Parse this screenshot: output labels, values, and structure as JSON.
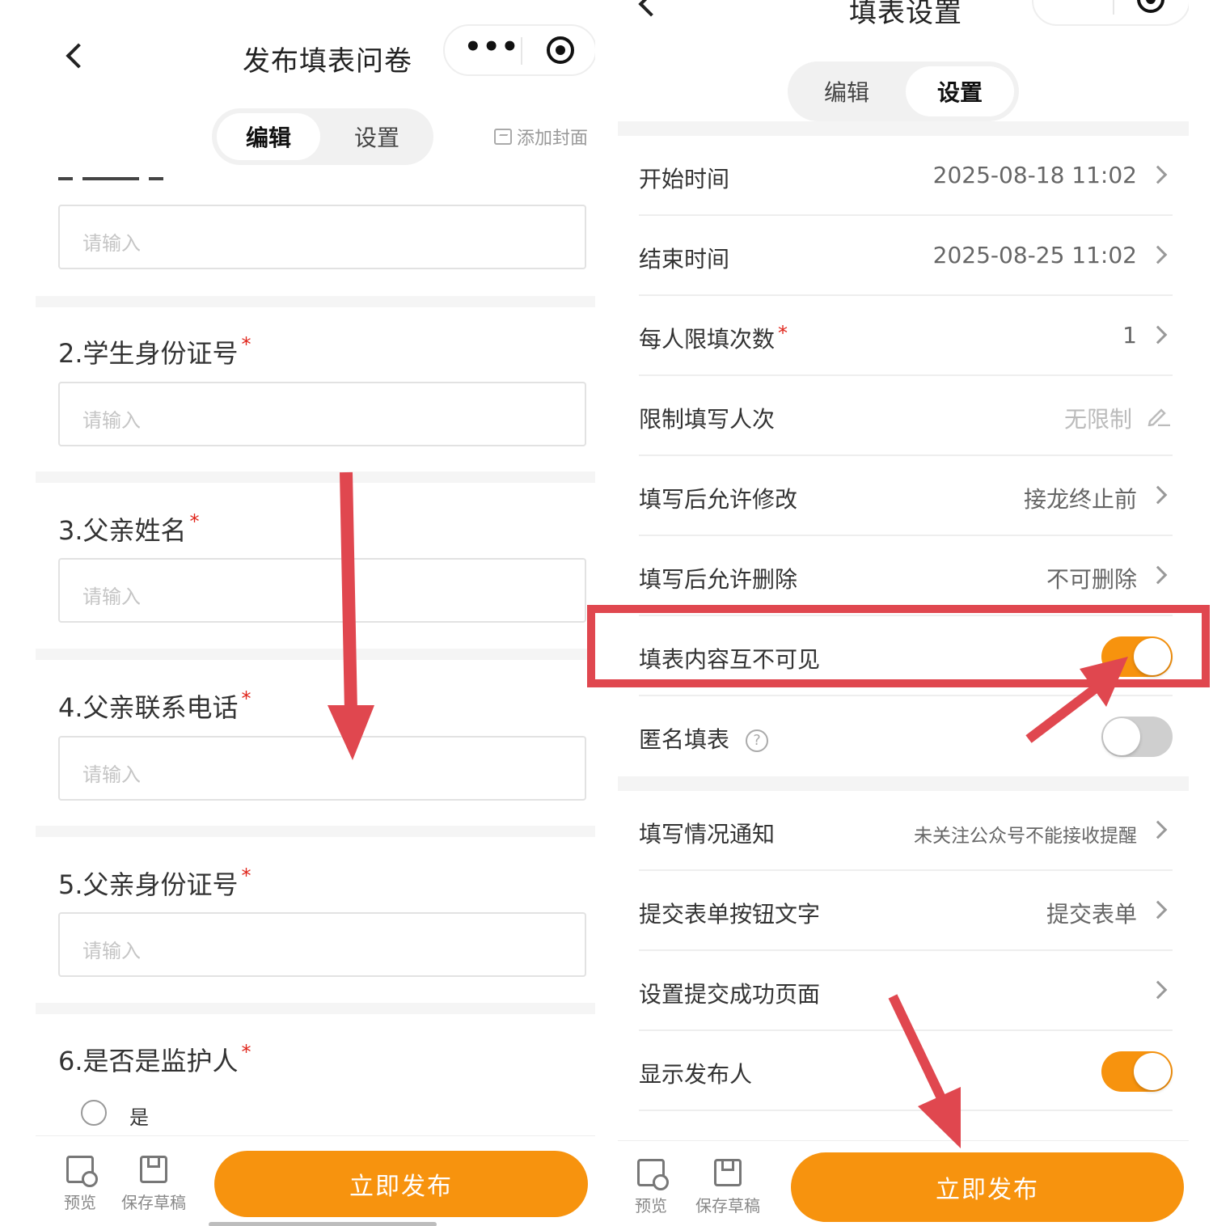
{
  "left": {
    "title": "发布填表问卷",
    "capsule_dots": "•••",
    "tabs": [
      {
        "label": "编辑",
        "active": true
      },
      {
        "label": "设置",
        "active": false
      }
    ],
    "add_cover": "添加封面",
    "questions": [
      {
        "label": "2.学生身份证号",
        "required": true,
        "placeholder": "请输入"
      },
      {
        "label": "3.父亲姓名",
        "required": true,
        "placeholder": "请输入"
      },
      {
        "label": "4.父亲联系电话",
        "required": true,
        "placeholder": "请输入"
      },
      {
        "label": "5.父亲身份证号",
        "required": true,
        "placeholder": "请输入"
      },
      {
        "label": "6.是否是监护人",
        "required": true,
        "option": "是"
      }
    ],
    "first_input_placeholder": "请输入",
    "required_mark": "*",
    "bottom": {
      "preview": "预览",
      "draft": "保存草稿",
      "publish": "立即发布"
    }
  },
  "right": {
    "title": "填表设置",
    "capsule_dots": "•••",
    "tabs": [
      {
        "label": "编辑",
        "active": false
      },
      {
        "label": "设置",
        "active": true
      }
    ],
    "rows": [
      {
        "label": "开始时间",
        "value": "2025-08-18 11:02"
      },
      {
        "label": "结束时间",
        "value": "2025-08-25 11:02"
      },
      {
        "label": "每人限填次数",
        "required": true,
        "value": "1"
      },
      {
        "label": "限制填写人次",
        "value": "无限制"
      },
      {
        "label": "填写后允许修改",
        "value": "接龙终止前"
      },
      {
        "label": "填写后允许删除",
        "value": "不可删除"
      },
      {
        "label": "填表内容互不可见",
        "switch": true
      },
      {
        "label": "匿名填表",
        "switch": false
      },
      {
        "label": "填写情况通知",
        "value": "未关注公众号不能接收提醒"
      },
      {
        "label": "提交表单按钮文字",
        "value": "提交表单"
      },
      {
        "label": "设置提交成功页面",
        "value": ""
      },
      {
        "label": "显示发布人",
        "switch": true
      }
    ],
    "help_glyph": "?",
    "required_mark": "*",
    "bottom": {
      "preview": "预览",
      "draft": "保存草稿",
      "publish": "立即发布"
    }
  },
  "colors": {
    "accent": "#f7930e",
    "annotation": "#e0474f",
    "required": "#e0251b"
  }
}
